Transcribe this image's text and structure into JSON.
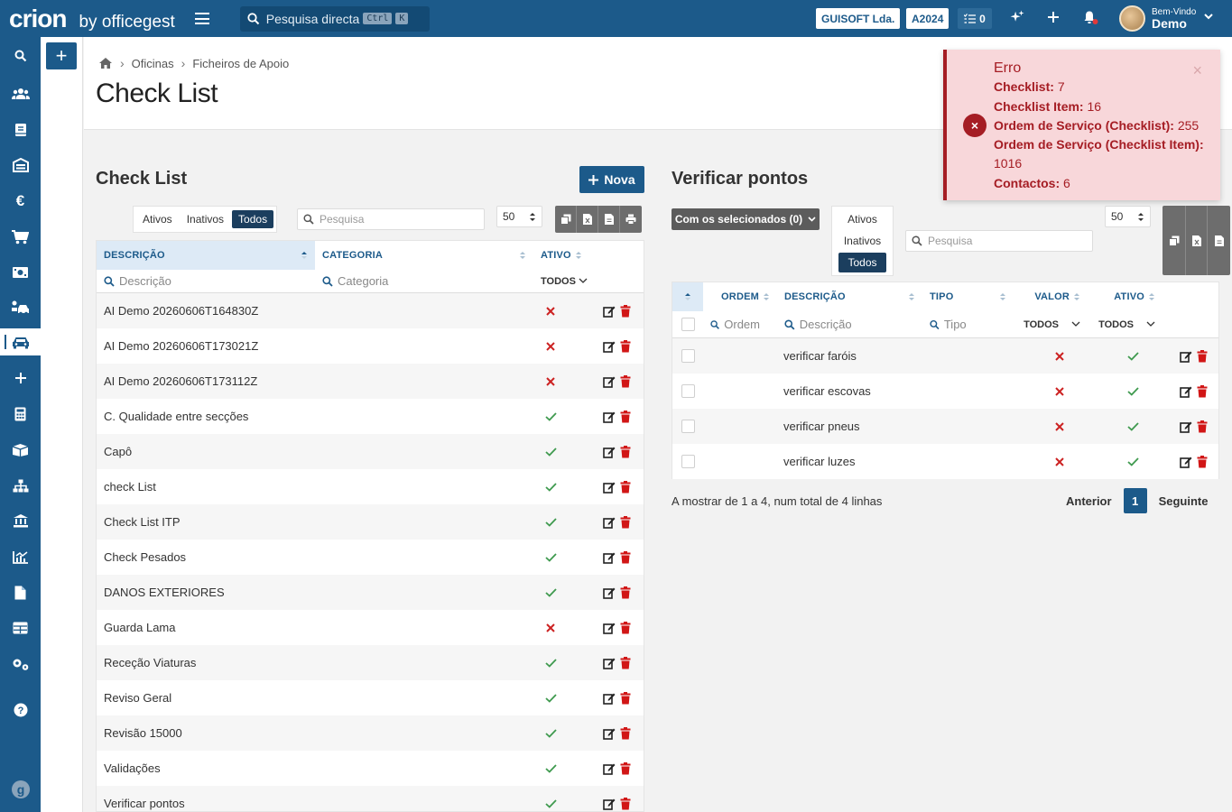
{
  "app": {
    "logo": "crion",
    "by": "by officegest",
    "search_placeholder": "Pesquisa directa",
    "kbd1": "Ctrl",
    "kbd2": "K",
    "company": "GUISOFT Lda.",
    "year": "A2024",
    "tasks_count": "0",
    "welcome_label": "Bem-Vindo",
    "user_name": "Demo"
  },
  "breadcrumb": [
    "Oficinas",
    "Ficheiros de Apoio"
  ],
  "page_title": "Check List",
  "left": {
    "title": "Check List",
    "new_label": "Nova",
    "filters": [
      "Ativos",
      "Inativos",
      "Todos"
    ],
    "active_filter": "Todos",
    "search_placeholder": "Pesquisa",
    "page_size": "50",
    "columns": {
      "descricao": "DESCRIÇÃO",
      "categoria": "CATEGORIA",
      "ativo": "ATIVO"
    },
    "filter_placeholders": {
      "descricao": "Descrição",
      "categoria": "Categoria",
      "ativo": "TODOS"
    },
    "rows": [
      {
        "descricao": "AI Demo 20260606T164830Z",
        "ativo": false
      },
      {
        "descricao": "AI Demo 20260606T173021Z",
        "ativo": false
      },
      {
        "descricao": "AI Demo 20260606T173112Z",
        "ativo": false
      },
      {
        "descricao": "C. Qualidade entre secções",
        "ativo": true
      },
      {
        "descricao": "Capô",
        "ativo": true
      },
      {
        "descricao": "check List",
        "ativo": true
      },
      {
        "descricao": "Check List ITP",
        "ativo": true
      },
      {
        "descricao": "Check Pesados",
        "ativo": true
      },
      {
        "descricao": "DANOS EXTERIORES",
        "ativo": true
      },
      {
        "descricao": "Guarda Lama",
        "ativo": false
      },
      {
        "descricao": "Receção Viaturas",
        "ativo": true
      },
      {
        "descricao": "Reviso Geral",
        "ativo": true
      },
      {
        "descricao": "Revisão 15000",
        "ativo": true
      },
      {
        "descricao": "Validações",
        "ativo": true
      },
      {
        "descricao": "Verificar pontos",
        "ativo": true
      }
    ]
  },
  "right": {
    "title": "Verificar pontos",
    "bulk_label": "Com os selecionados (0)",
    "filters": [
      "Ativos",
      "Inativos",
      "Todos"
    ],
    "active_filter": "Todos",
    "search_placeholder": "Pesquisa",
    "page_size": "50",
    "columns": {
      "ordem": "ORDEM",
      "descricao": "DESCRIÇÃO",
      "tipo": "TIPO",
      "valor": "VALOR",
      "ativo": "ATIVO"
    },
    "filter_placeholders": {
      "ordem": "Ordem",
      "descricao": "Descrição",
      "tipo": "Tipo",
      "valor": "TODOS",
      "ativo": "TODOS"
    },
    "rows": [
      {
        "descricao": "verificar faróis",
        "valor": false,
        "ativo": true
      },
      {
        "descricao": "verificar escovas",
        "valor": false,
        "ativo": true
      },
      {
        "descricao": "verificar pneus",
        "valor": false,
        "ativo": true
      },
      {
        "descricao": "verificar luzes",
        "valor": false,
        "ativo": true
      }
    ],
    "footer": "A mostrar de 1 a 4, num total de 4 linhas",
    "prev_label": "Anterior",
    "current_page": "1",
    "next_label": "Seguinte"
  },
  "toast": {
    "title": "Erro",
    "lines": [
      {
        "label": "Checklist:",
        "value": "7"
      },
      {
        "label": "Checklist Item:",
        "value": "16"
      },
      {
        "label": "Ordem de Serviço (Checklist):",
        "value": "255"
      },
      {
        "label": "Ordem de Serviço (Checklist Item):",
        "value": "1016"
      },
      {
        "label": "Contactos:",
        "value": "6"
      }
    ],
    "close": "×",
    "icon": "×"
  },
  "colors": {
    "primary": "#1c5a8a",
    "error": "#a51d24",
    "error_bg": "#f8d7da",
    "ok": "#3f9a4f",
    "no": "#cc2222"
  }
}
